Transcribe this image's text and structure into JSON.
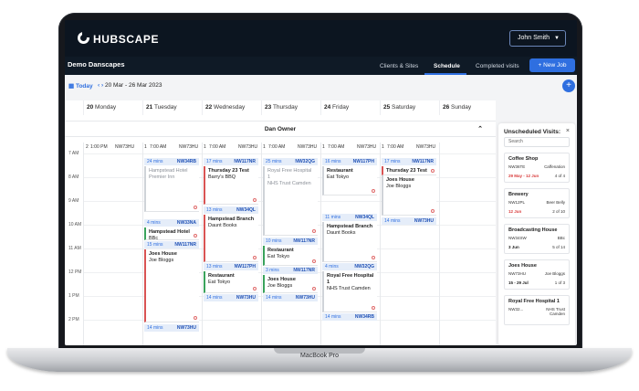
{
  "device_label": "MacBook Pro",
  "brand": {
    "name": "HUBSCAPE"
  },
  "user": {
    "name": "John Smith"
  },
  "org": "Demo Danscapes",
  "nav": {
    "tabs": [
      "Clients & Sites",
      "Schedule",
      "Completed visits"
    ],
    "active": "Schedule",
    "new_job": "+ New Job"
  },
  "toolbar": {
    "today": "Today",
    "prev": "‹",
    "next": "›",
    "range": "20 Mar - 26 Mar 2023",
    "add": "+"
  },
  "calendar": {
    "days": [
      {
        "num": "20",
        "name": "Monday"
      },
      {
        "num": "21",
        "name": "Tuesday"
      },
      {
        "num": "22",
        "name": "Wednesday"
      },
      {
        "num": "23",
        "name": "Thursday"
      },
      {
        "num": "24",
        "name": "Friday"
      },
      {
        "num": "25",
        "name": "Saturday"
      },
      {
        "num": "26",
        "name": "Sunday"
      }
    ],
    "owner": "Dan Owner",
    "subheaders": [
      "2",
      "1:00 PM",
      "NW73HU",
      "1",
      "7:00 AM",
      "NW73HU",
      "1",
      "7:00 AM",
      "NW73HU",
      "1",
      "7:00 AM",
      "NW73HU",
      "1",
      "7:00 AM",
      "NW73HU",
      "1",
      "7:00 AM",
      "NW73HU"
    ],
    "hours": [
      "7 AM",
      "8 AM",
      "9 AM",
      "10 AM",
      "11 AM",
      "12 PM",
      "1 PM",
      "2 PM"
    ],
    "travel": [
      {
        "mins": "24 mins",
        "pc": "NW34RB"
      },
      {
        "mins": "4 mins",
        "pc": "NW33NA"
      },
      {
        "mins": "15 mins",
        "pc": "NW117NR"
      },
      {
        "mins": "14 mins",
        "pc": "NW73HU"
      },
      {
        "mins": "17 mins",
        "pc": "NW117NR"
      },
      {
        "mins": "13 mins",
        "pc": "NW34QL"
      },
      {
        "mins": "13 mins",
        "pc": "NW117PH"
      },
      {
        "mins": "14 mins",
        "pc": "NW73HU"
      },
      {
        "mins": "25 mins",
        "pc": "NW32QG"
      },
      {
        "mins": "10 mins",
        "pc": "NW117NR"
      },
      {
        "mins": "3 mins",
        "pc": "NW117NR"
      },
      {
        "mins": "14 mins",
        "pc": "NW73HU"
      },
      {
        "mins": "16 mins",
        "pc": "NW117PH"
      },
      {
        "mins": "11 mins",
        "pc": "NW34QL"
      },
      {
        "mins": "4 mins",
        "pc": "NW32QG"
      },
      {
        "mins": "14 mins",
        "pc": "NW34RB"
      },
      {
        "mins": "17 mins",
        "pc": "NW117NR"
      },
      {
        "mins": "14 mins",
        "pc": "NW73HU"
      }
    ],
    "jobs": [
      {
        "title": "Hampstead Hotel",
        "sub": "Premier Inn"
      },
      {
        "title": "Hampstead Hotel",
        "sub": "BBc"
      },
      {
        "title": "Joes House",
        "sub": "Joe Bloggs"
      },
      {
        "title": "Thursday 23 Test",
        "sub": "Barry's BBQ"
      },
      {
        "title": "Hampstead Branch",
        "sub": "Daunt Books"
      },
      {
        "title": "Restaurant",
        "sub": "Eat Tokyo"
      },
      {
        "title": "Royal Free Hospital 1",
        "sub": "NHS Trust Camden"
      },
      {
        "title": "Restaurant",
        "sub": "Eat Tokyo"
      },
      {
        "title": "Joes House",
        "sub": "Joe Bloggs"
      },
      {
        "title": "Restaurant",
        "sub": "Eat Tokyo"
      },
      {
        "title": "Hampstead Branch",
        "sub": "Daunt Books"
      },
      {
        "title": "Royal Free Hospital 1",
        "sub": "NHS Trust Camden"
      },
      {
        "title": "Thursday 23 Test",
        "sub": ""
      },
      {
        "title": "Joes House",
        "sub": "Joe Bloggs"
      }
    ]
  },
  "panel": {
    "title": "Unscheduled Visits:",
    "close": "×",
    "search_placeholder": "Search",
    "cards": [
      {
        "name": "Coffee Shop",
        "postcode": "NW36TE",
        "client": "Caffenation",
        "dates": "29 May - 12 Jun",
        "count": "4 of 4",
        "date_color": "#d93b3b"
      },
      {
        "name": "Brewery",
        "postcode": "NW12PL",
        "client": "Beer Belly",
        "dates": "12 Jun",
        "count": "2 of 10",
        "date_color": "#d93b3b"
      },
      {
        "name": "Broadcasting House",
        "postcode": "NW34SW",
        "client": "BBc",
        "dates": "3 Jun",
        "count": "5 of 14",
        "date_color": "#222222"
      },
      {
        "name": "Joes House",
        "postcode": "NW73HU",
        "client": "Joe Bloggs",
        "dates": "15 - 29 Jul",
        "count": "1 of 3",
        "date_color": "#222222"
      },
      {
        "name": "Royal Free Hospital 1",
        "postcode": "NW32...",
        "client": "NHS Trust Camden",
        "dates": "",
        "count": "",
        "date_color": "#222222"
      }
    ]
  }
}
